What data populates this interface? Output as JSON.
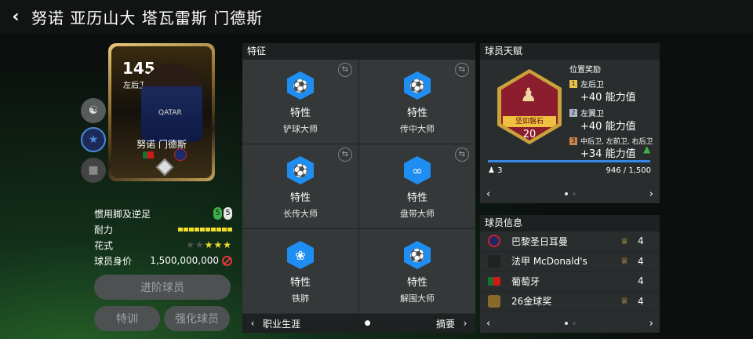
{
  "header": {
    "title": "努诺 亚历山大 塔瓦雷斯 门德斯"
  },
  "card": {
    "ovr": "145",
    "position": "左后卫",
    "name": "努诺 门德斯"
  },
  "stats": {
    "weak_foot_label": "惯用脚及逆足",
    "weak_foot_left": "5",
    "weak_foot_right": "5",
    "stamina_label": "耐力",
    "stamina_level": 10,
    "skill_label": "花式",
    "skill_stars": 3,
    "skill_stars_max": 5,
    "value_label": "球员身价",
    "value": "1,500,000,000"
  },
  "buttons": {
    "advance": "进阶球员",
    "train": "特训",
    "enhance": "强化球员"
  },
  "traits": {
    "title": "特征",
    "items": [
      {
        "type": "特性",
        "name": "铲球大师"
      },
      {
        "type": "特性",
        "name": "传中大师"
      },
      {
        "type": "特性",
        "name": "长传大师"
      },
      {
        "type": "特性",
        "name": "盘带大师"
      },
      {
        "type": "特性",
        "name": "铁肺"
      },
      {
        "type": "特性",
        "name": "解围大师"
      }
    ],
    "footer_left": "职业生涯",
    "footer_right": "摘要"
  },
  "talent": {
    "title": "球员天赋",
    "badge_label": "坚如磐石",
    "badge_level": "20",
    "rewards_title": "位置奖励",
    "rewards": [
      {
        "rank": "1",
        "positions": "左后卫",
        "bonus": "+40 能力值",
        "color": "#e8c24a"
      },
      {
        "rank": "2",
        "positions": "左翼卫",
        "bonus": "+40 能力值",
        "color": "#aab4c4"
      },
      {
        "rank": "3",
        "positions": "中后卫, 左前卫, 右后卫",
        "bonus": "+34 能力值",
        "color": "#c9824a"
      }
    ],
    "count": "3",
    "progress": "946 / 1,500",
    "progress_fraction": 0.63
  },
  "info": {
    "title": "球员信息",
    "rows": [
      {
        "name": "巴黎圣日耳曼",
        "level": "4"
      },
      {
        "name": "法甲 McDonald's",
        "level": "4"
      },
      {
        "name": "葡萄牙",
        "level": "4"
      },
      {
        "name": "26金球奖",
        "level": "4"
      }
    ]
  },
  "colors": {
    "accent": "#1e8ef3",
    "stamina": "#f2de2a",
    "badge": "#8b1d2e"
  }
}
